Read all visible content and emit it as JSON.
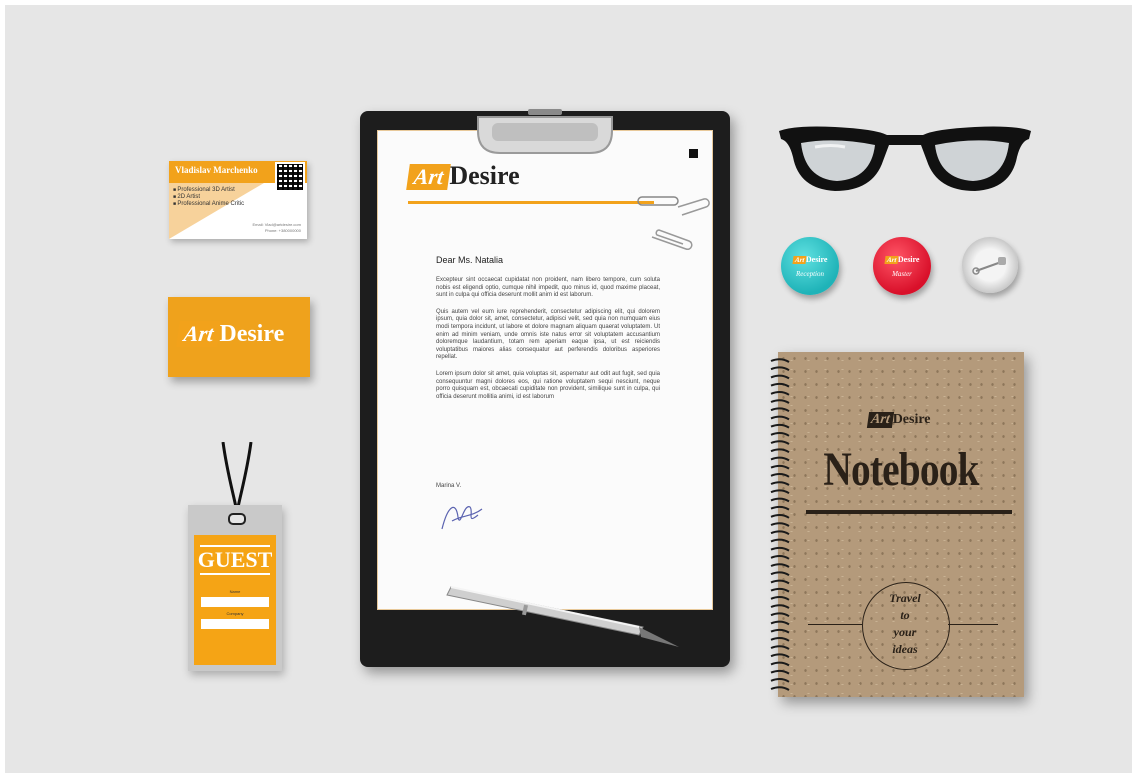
{
  "brand": {
    "logo_art": "Art",
    "logo_desire": "Desire"
  },
  "business_card": {
    "name": "Vladislav Marchenko",
    "roles": [
      "Professional 3D Artist",
      "2D Artist",
      "Professional Anime Critic"
    ],
    "contact_line1": "Email: Vlad@artdesire.com",
    "contact_line2": "Phone: +380000000"
  },
  "badge": {
    "title": "GUEST",
    "field1_label": "Name",
    "field2_label": "Company"
  },
  "letter": {
    "greeting": "Dear Ms. Natalia",
    "paragraphs": [
      "Excepteur sint occaecat cupidatat non proident, nam libero tempore, cum soluta nobis est eligendi optio, cumque nihil impedit, quo minus id, quod maxime placeat, sunt in culpa qui officia deserunt mollit anim id est laborum.",
      "Quis autem vel eum iure reprehenderit, consectetur adipiscing elit, qui dolorem ipsum, quia dolor sit, amet, consectetur, adipisci velit, sed quia non numquam eius modi tempora incidunt, ut labore et dolore magnam aliquam quaerat voluptatem. Ut enim ad minim veniam, unde omnis iste natus error sit voluptatem accusantium doloremque laudantium, totam rem aperiam eaque ipsa, ut est reiciendis voluptatibus maiores alias consequatur aut perferendis doloribus asperiores repellat.",
      "Lorem ipsum dolor sit amet, quia voluptas sit, aspernatur aut odit aut fugit, sed quia consequuntur magni dolores eos, qui ratione voluptatem sequi nesciunt, neque porro quisquam est, obcaecati cupiditate non provident, similique sunt in culpa, qui officia deserunt mollitia animi, id est laborum"
    ],
    "signoff": "Marina V."
  },
  "buttons": [
    {
      "script": "Reception",
      "color": "#1fb3b8"
    },
    {
      "script": "Master",
      "color": "#d9102a"
    }
  ],
  "notebook": {
    "title": "Notebook",
    "motto_lines": [
      "Travel",
      "to",
      "your",
      "ideas"
    ]
  },
  "colors": {
    "accent": "#f2a21b",
    "kraft": "#b49a7b",
    "ink": "#2a2118",
    "background": "#e6e6e6"
  },
  "icons": [
    "paperclip-icon",
    "qr-code-icon",
    "signature-icon",
    "pen-icon",
    "glasses-icon",
    "spiral-binding-icon"
  ]
}
